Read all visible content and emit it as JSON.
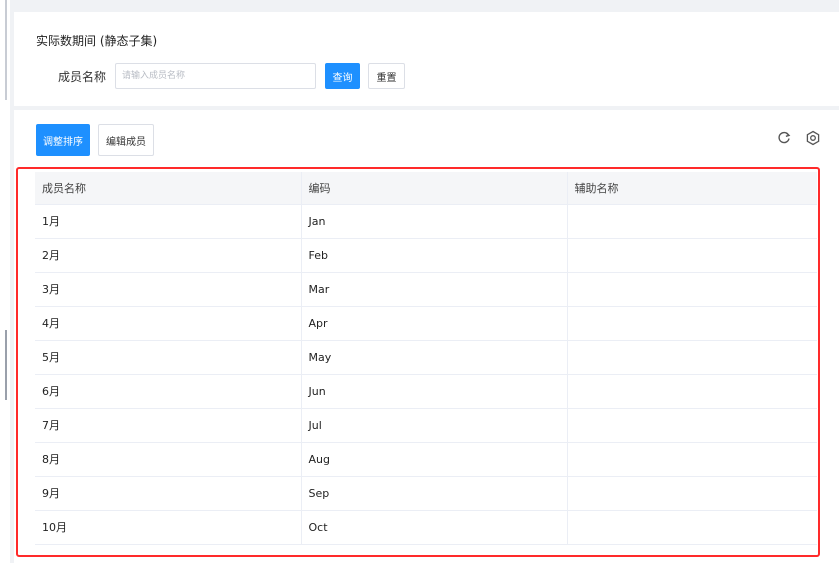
{
  "filter": {
    "title": "实际数期间 (静态子集)",
    "member_name_label": "成员名称",
    "member_name_placeholder": "请输入成员名称",
    "member_name_value": "",
    "query_label": "查询",
    "reset_label": "重置"
  },
  "toolbar": {
    "sort_label": "调整排序",
    "edit_label": "编辑成员",
    "refresh_icon": "refresh-icon",
    "settings_icon": "settings-icon"
  },
  "table": {
    "columns": [
      "成员名称",
      "编码",
      "辅助名称"
    ],
    "rows": [
      [
        "1月",
        "Jan",
        ""
      ],
      [
        "2月",
        "Feb",
        ""
      ],
      [
        "3月",
        "Mar",
        ""
      ],
      [
        "4月",
        "Apr",
        ""
      ],
      [
        "5月",
        "May",
        ""
      ],
      [
        "6月",
        "Jun",
        ""
      ],
      [
        "7月",
        "Jul",
        ""
      ],
      [
        "8月",
        "Aug",
        ""
      ],
      [
        "9月",
        "Sep",
        ""
      ],
      [
        "10月",
        "Oct",
        ""
      ]
    ]
  },
  "colors": {
    "primary": "#1e90ff",
    "highlight": "#ff2a2a",
    "header_bg": "#f5f6f8",
    "page_bg": "#f0f2f5"
  }
}
